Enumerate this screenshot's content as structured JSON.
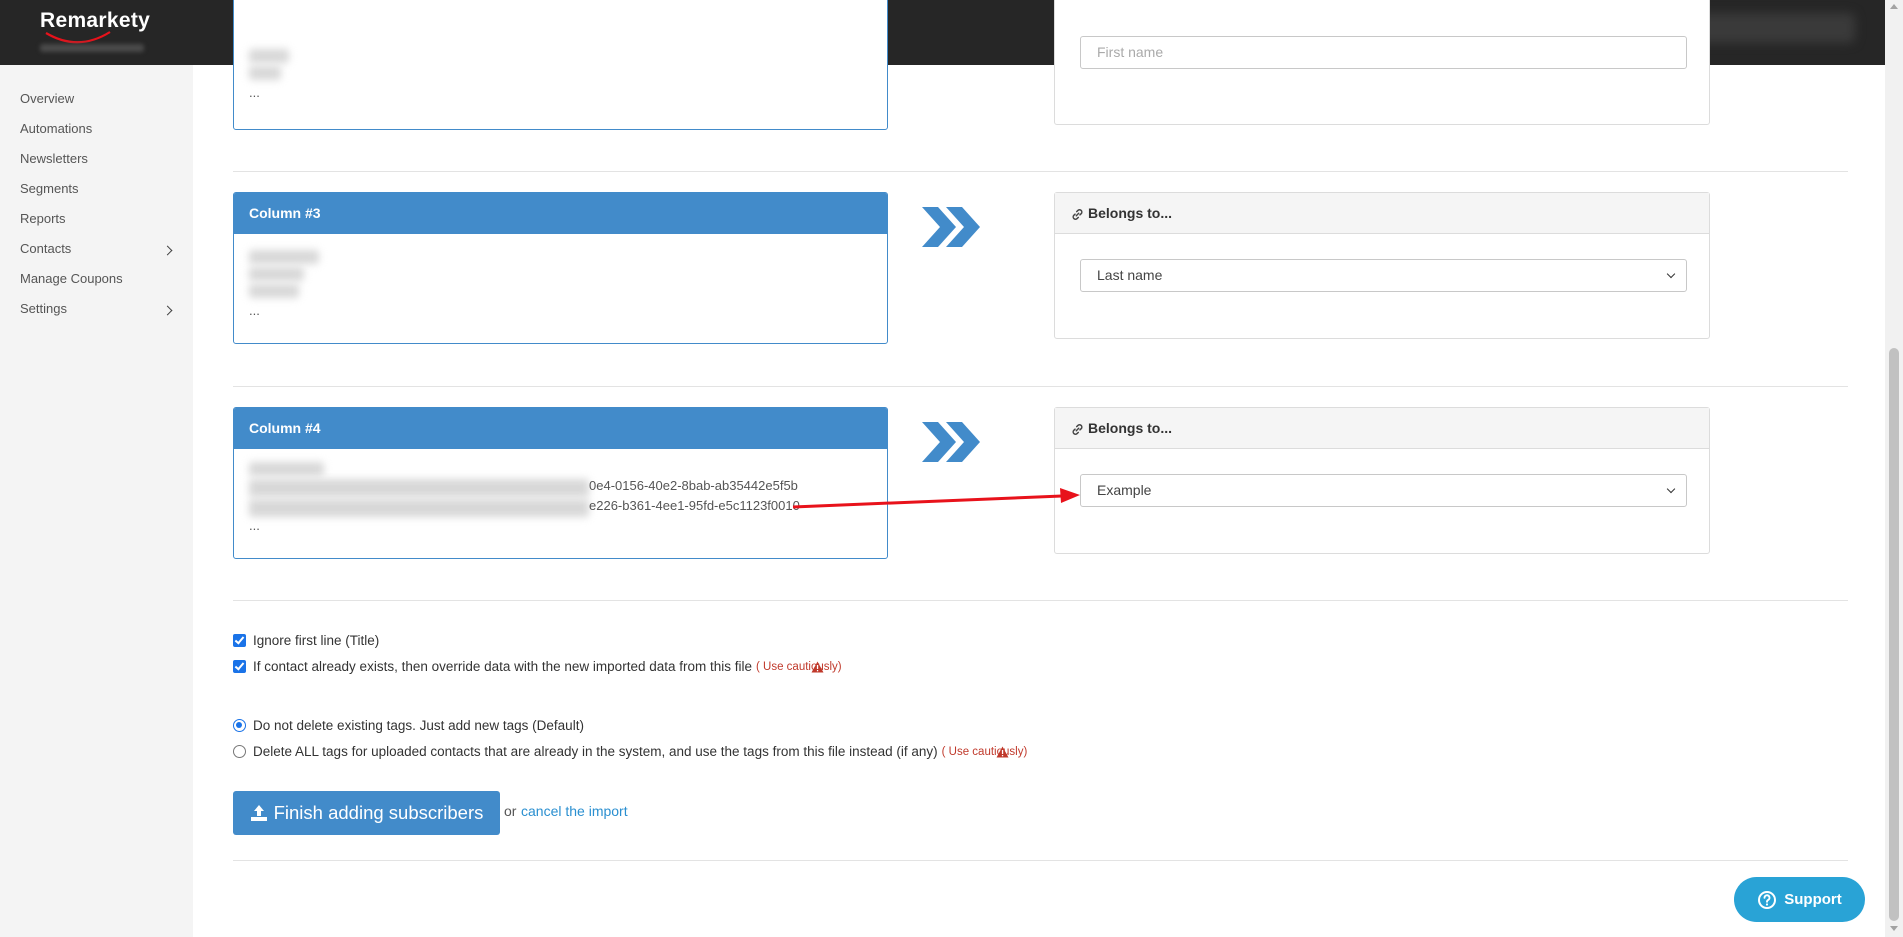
{
  "header": {
    "logo_text": "Remarkety",
    "brand_color": "#262626"
  },
  "sidebar": {
    "items": [
      {
        "label": "Overview",
        "has_submenu": false
      },
      {
        "label": "Automations",
        "has_submenu": false
      },
      {
        "label": "Newsletters",
        "has_submenu": false
      },
      {
        "label": "Segments",
        "has_submenu": false
      },
      {
        "label": "Reports",
        "has_submenu": false
      },
      {
        "label": "Contacts",
        "has_submenu": true
      },
      {
        "label": "Manage Coupons",
        "has_submenu": false
      },
      {
        "label": "Settings",
        "has_submenu": true
      }
    ]
  },
  "mapping": {
    "partial_top": {
      "sample_last": "...",
      "select_value": "First name"
    },
    "columns": [
      {
        "title": "Column #3",
        "sample_last": "...",
        "belongs_label": "Belongs to...",
        "select_value": "Last name"
      },
      {
        "title": "Column #4",
        "sample_visible_1": "0e4-0156-40e2-8bab-ab35442e5f5b",
        "sample_visible_2": "e226-b361-4ee1-95fd-e5c1123f0010",
        "sample_last": "...",
        "belongs_label": "Belongs to...",
        "select_value": "Example"
      }
    ]
  },
  "options": {
    "ignore_first_line": {
      "label": "Ignore first line (Title)",
      "checked": true
    },
    "override_data": {
      "label": "If contact already exists, then override data with the new imported data from this file",
      "checked": true,
      "warning": "(  Use cautiously)"
    },
    "tags_keep": {
      "label": "Do not delete existing tags. Just add new tags (Default)",
      "selected": true
    },
    "tags_replace": {
      "label": "Delete ALL tags for uploaded contacts that are already in the system, and use the tags from this file instead (if any)",
      "selected": false,
      "warning": "(  Use cautiously)"
    }
  },
  "actions": {
    "finish_label": "Finish adding subscribers",
    "or_text": "or",
    "cancel_label": "cancel the import",
    "support_label": "Support"
  },
  "colors": {
    "accent": "#428bca",
    "link": "#2a8fd0",
    "warning": "#c0392b",
    "support": "#29a3d6",
    "annotation_arrow": "#e8121b"
  },
  "icons": {
    "chevrons": "double-chevron-right-icon",
    "link": "link-icon",
    "warning": "warning-triangle-icon",
    "upload": "upload-icon",
    "support": "question-circle-icon"
  }
}
